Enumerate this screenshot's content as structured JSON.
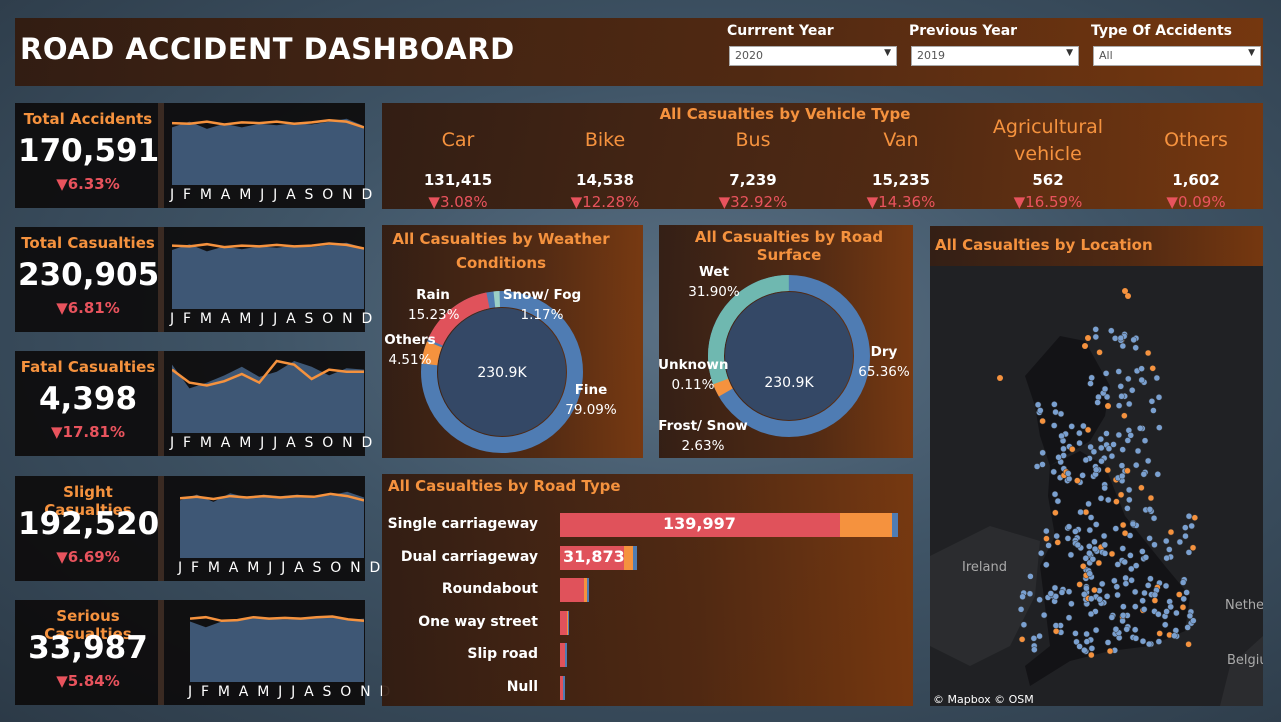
{
  "header": {
    "title": "ROAD ACCIDENT DASHBOARD",
    "filters": [
      {
        "label": "Currrent Year",
        "value": "2020"
      },
      {
        "label": "Previous Year",
        "value": "2019"
      },
      {
        "label": "Type Of Accidents",
        "value": "All"
      }
    ]
  },
  "months_label": "J F M A M J J A S O N D",
  "kpis": [
    {
      "title": "Total Accidents",
      "value": "170,591",
      "delta": "▼6.33%",
      "current": [
        0.86,
        0.85,
        0.88,
        0.84,
        0.87,
        0.86,
        0.88,
        0.85,
        0.87,
        0.9,
        0.88,
        0.8
      ],
      "previous": [
        0.8,
        0.88,
        0.78,
        0.85,
        0.8,
        0.85,
        0.83,
        0.86,
        0.84,
        0.88,
        0.92,
        0.82
      ]
    },
    {
      "title": "Total Casualties",
      "value": "230,905",
      "delta": "▼6.81%",
      "current": [
        0.88,
        0.87,
        0.9,
        0.86,
        0.88,
        0.87,
        0.89,
        0.87,
        0.88,
        0.91,
        0.89,
        0.84
      ],
      "previous": [
        0.82,
        0.9,
        0.8,
        0.87,
        0.83,
        0.87,
        0.85,
        0.88,
        0.86,
        0.89,
        0.92,
        0.85
      ]
    },
    {
      "title": "Fatal Casualties",
      "value": "4,398",
      "delta": "▼17.81%",
      "current": [
        0.88,
        0.7,
        0.66,
        0.72,
        0.82,
        0.7,
        1.0,
        0.95,
        0.75,
        0.88,
        0.85,
        0.85
      ],
      "previous": [
        0.95,
        0.62,
        0.7,
        0.8,
        0.92,
        0.78,
        0.85,
        1.0,
        0.92,
        0.8,
        0.9,
        0.88
      ]
    },
    {
      "title": "Slight Casualties",
      "value": "192,520",
      "delta": "▼6.69%",
      "current": [
        0.83,
        0.85,
        0.82,
        0.86,
        0.84,
        0.86,
        0.84,
        0.86,
        0.85,
        0.89,
        0.86,
        0.8
      ],
      "previous": [
        0.8,
        0.88,
        0.78,
        0.9,
        0.84,
        0.88,
        0.86,
        0.88,
        0.85,
        0.87,
        0.92,
        0.84
      ]
    },
    {
      "title": "Serious Casualties",
      "value": "33,987",
      "delta": "▼5.84%",
      "current": [
        0.88,
        0.9,
        0.85,
        0.86,
        0.9,
        0.88,
        0.89,
        0.88,
        0.9,
        0.91,
        0.87,
        0.85
      ],
      "previous": [
        0.84,
        0.76,
        0.84,
        0.85,
        0.9,
        0.88,
        0.87,
        0.88,
        0.89,
        0.9,
        0.86,
        0.88
      ]
    }
  ],
  "vehicle": {
    "title": "All Casualties by Vehicle Type",
    "items": [
      {
        "name": "Car",
        "value": "131,415",
        "delta": "▼3.08%"
      },
      {
        "name": "Bike",
        "value": "14,538",
        "delta": "▼12.28%"
      },
      {
        "name": "Bus",
        "value": "7,239",
        "delta": "▼32.92%"
      },
      {
        "name": "Van",
        "value": "15,235",
        "delta": "▼14.36%"
      },
      {
        "name": "Agricultural vehicle",
        "value": "562",
        "delta": "▼16.59%"
      },
      {
        "name": "Others",
        "value": "1,602",
        "delta": "▼0.09%"
      }
    ]
  },
  "weather": {
    "title": "All Casualties by Weather Conditions",
    "center": "230.9K",
    "labels": [
      {
        "name": "Rain",
        "pct": "15.23%"
      },
      {
        "name": "Snow/ Fog",
        "pct": "1.17%"
      },
      {
        "name": "Others",
        "pct": "4.51%"
      },
      {
        "name": "Fine",
        "pct": "79.09%"
      }
    ]
  },
  "surface": {
    "title": "All Casualties by Road Surface",
    "center": "230.9K",
    "labels": [
      {
        "name": "Wet",
        "pct": "31.90%"
      },
      {
        "name": "Dry",
        "pct": "65.36%"
      },
      {
        "name": "Unknown",
        "pct": "0.11%"
      },
      {
        "name": "Frost/ Snow",
        "pct": "2.63%"
      }
    ]
  },
  "road_type": {
    "title": "All Casualties by Road Type",
    "labels": [
      "Single carriageway",
      "Dual carriageway",
      "Roundabout",
      "One way street",
      "Slip road",
      "Null"
    ],
    "value_labels": [
      "139,997",
      "31,873",
      "",
      "",
      "",
      ""
    ]
  },
  "location": {
    "title": "All Casualties by Location",
    "map_labels": {
      "ireland": "Ireland",
      "neth": "Nether",
      "belg": "Belgiu"
    },
    "credit": "© Mapbox © OSM"
  },
  "colors": {
    "accent": "#f5923e",
    "negative": "#e8535d",
    "blue": "#4f7cb3",
    "teal": "#6fb8b0",
    "red": "#e0525b"
  },
  "chart_data": [
    {
      "type": "area",
      "title": "Total Accidents",
      "x": [
        "J",
        "F",
        "M",
        "A",
        "M",
        "J",
        "J",
        "A",
        "S",
        "O",
        "N",
        "D"
      ],
      "series": [
        {
          "name": "current",
          "values": [
            0.86,
            0.85,
            0.88,
            0.84,
            0.87,
            0.86,
            0.88,
            0.85,
            0.87,
            0.9,
            0.88,
            0.8
          ]
        },
        {
          "name": "previous",
          "values": [
            0.8,
            0.88,
            0.78,
            0.85,
            0.8,
            0.85,
            0.83,
            0.86,
            0.84,
            0.88,
            0.92,
            0.82
          ]
        }
      ]
    },
    {
      "type": "pie",
      "title": "All Casualties by Weather Conditions",
      "categories": [
        "Fine",
        "Others",
        "Rain",
        "Snow/ Fog"
      ],
      "values": [
        79.09,
        4.51,
        15.23,
        1.17
      ]
    },
    {
      "type": "pie",
      "title": "All Casualties by Road Surface",
      "categories": [
        "Dry",
        "Frost/ Snow",
        "Unknown",
        "Wet"
      ],
      "values": [
        65.36,
        2.63,
        0.11,
        31.9
      ]
    },
    {
      "type": "bar",
      "title": "All Casualties by Road Type",
      "categories": [
        "Single carriageway",
        "Dual carriageway",
        "Roundabout",
        "One way street",
        "Slip road",
        "Null"
      ],
      "series": [
        {
          "name": "red",
          "values": [
            139997,
            31873,
            12000,
            3500,
            2400,
            1500
          ]
        },
        {
          "name": "orange",
          "values": [
            26000,
            4600,
            1700,
            400,
            250,
            150
          ]
        },
        {
          "name": "blue",
          "values": [
            3000,
            400,
            200,
            50,
            30,
            20
          ]
        }
      ]
    }
  ]
}
